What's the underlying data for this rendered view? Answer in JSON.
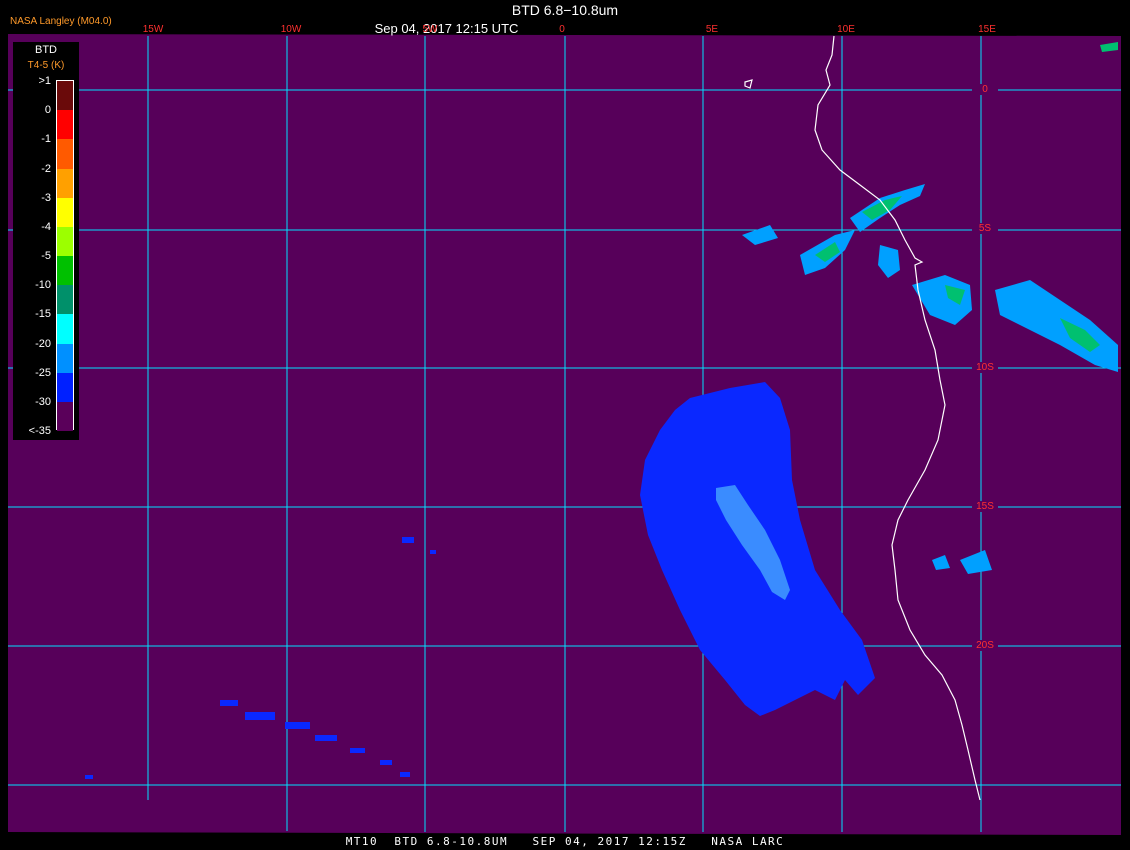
{
  "header": {
    "title": "BTD 6.8−10.8um",
    "subtitle": "Sep 04, 2017 12:15 UTC",
    "agency": "NASA Langley (M04.0)"
  },
  "footer": {
    "text": "MT10  BTD 6.8-10.8UM   SEP 04, 2017 12:15Z   NASA LARC"
  },
  "legend": {
    "title": "BTD",
    "subtitle": "T4-5 (K)",
    "labels": [
      ">1",
      "0",
      "-1",
      "-2",
      "-3",
      "-4",
      "-5",
      "-10",
      "-15",
      "-20",
      "-25",
      "-30",
      "<-35"
    ],
    "colors": [
      "#6a0a0a",
      "#ff0000",
      "#ff5a00",
      "#ffa000",
      "#ffff00",
      "#9cff00",
      "#00c000",
      "#00906a",
      "#00ffff",
      "#0090ff",
      "#0020ff",
      "#5a005a"
    ]
  },
  "map": {
    "background": "#57005a",
    "grid_color": "#00e0ff",
    "coastline_color": "#ffffff",
    "label_color": "#ff3030",
    "lon_labels": [
      "15W",
      "10W",
      "5W",
      "0",
      "5E",
      "10E",
      "15E"
    ],
    "lat_labels": [
      "0",
      "5S",
      "10S",
      "15S",
      "20S"
    ]
  }
}
